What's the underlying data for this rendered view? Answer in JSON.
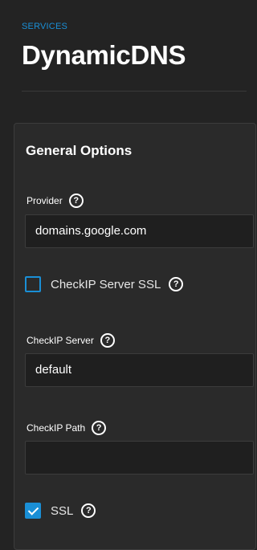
{
  "header": {
    "breadcrumb": "SERVICES",
    "title": "DynamicDNS"
  },
  "card": {
    "title": "General Options",
    "provider": {
      "label": "Provider",
      "value": "domains.google.com"
    },
    "checkip_server_ssl": {
      "label": "CheckIP Server SSL",
      "checked": false
    },
    "checkip_server": {
      "label": "CheckIP Server",
      "value": "default"
    },
    "checkip_path": {
      "label": "CheckIP Path",
      "value": ""
    },
    "ssl": {
      "label": "SSL",
      "checked": true
    }
  },
  "colors": {
    "accent": "#1a8fd6",
    "background": "#232323",
    "card": "#2a2a2a"
  },
  "icons": {
    "help": "help-icon",
    "checkbox_checked": "check-icon"
  }
}
